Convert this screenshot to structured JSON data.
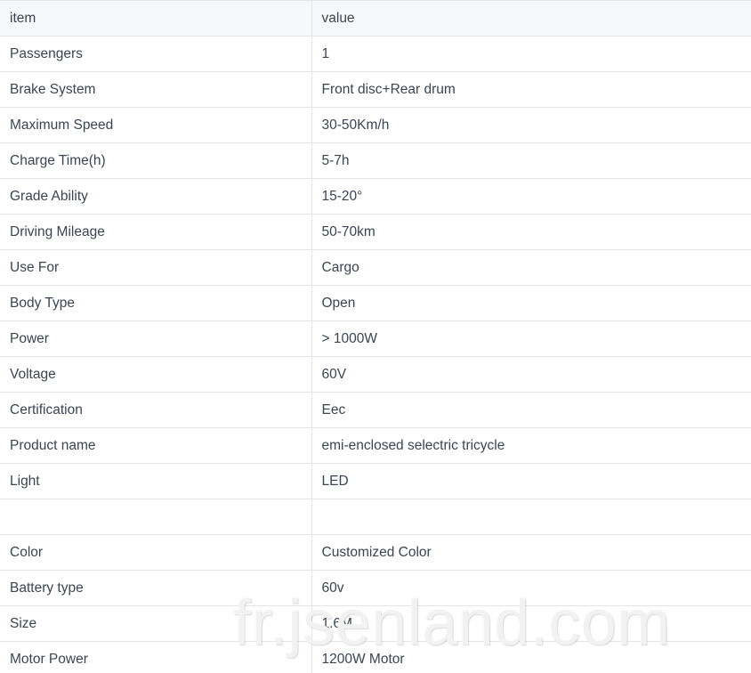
{
  "table": {
    "columns": [
      "item",
      "value"
    ],
    "rows": [
      {
        "item": "Passengers",
        "value": "1"
      },
      {
        "item": "Brake System",
        "value": "Front disc+Rear drum"
      },
      {
        "item": "Maximum Speed",
        "value": "30-50Km/h"
      },
      {
        "item": "Charge Time(h)",
        "value": "5-7h"
      },
      {
        "item": "Grade Ability",
        "value": "15-20°"
      },
      {
        "item": "Driving Mileage",
        "value": "50-70km"
      },
      {
        "item": "Use For",
        "value": "Cargo"
      },
      {
        "item": "Body Type",
        "value": "Open"
      },
      {
        "item": "Power",
        "value": "> 1000W"
      },
      {
        "item": "Voltage",
        "value": "60V"
      },
      {
        "item": "Certification",
        "value": "Eec"
      },
      {
        "item": "Product name",
        "value": "emi-enclosed selectric tricycle"
      },
      {
        "item": "Light",
        "value": "LED"
      },
      {
        "item": "",
        "value": ""
      },
      {
        "item": "Color",
        "value": "Customized Color"
      },
      {
        "item": "Battery type",
        "value": "60v"
      },
      {
        "item": "Size",
        "value": "1.6M"
      },
      {
        "item": "Motor Power",
        "value": "1200W Motor"
      }
    ]
  },
  "watermark": {
    "text": "fr.jsenland.com",
    "color": "#f2f2f2"
  },
  "colors": {
    "header_background": "#f7f8fa",
    "border": "#e3e5e8",
    "text": "#3d4451",
    "page_background": "#ffffff"
  }
}
